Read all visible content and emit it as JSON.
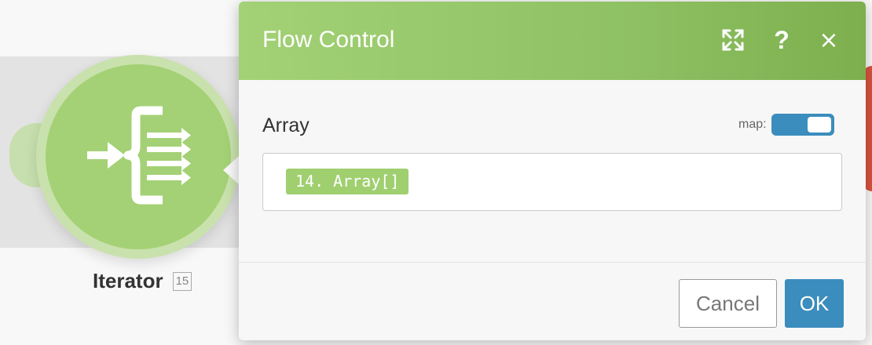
{
  "module": {
    "name": "Iterator",
    "id_badge": "15",
    "icon": "iterator-icon",
    "color": "#a4d175"
  },
  "dialog": {
    "title": "Flow Control",
    "header_color": "#8fc264",
    "header_icons": [
      "expand-icon",
      "help-icon",
      "close-icon"
    ],
    "help_glyph": "?",
    "close_glyph": "×",
    "field": {
      "label": "Array",
      "map_label": "map:",
      "map_enabled": true,
      "value_pill": "14. Array[]"
    },
    "footer": {
      "cancel_label": "Cancel",
      "ok_label": "OK",
      "ok_color": "#3b8dbd"
    }
  }
}
